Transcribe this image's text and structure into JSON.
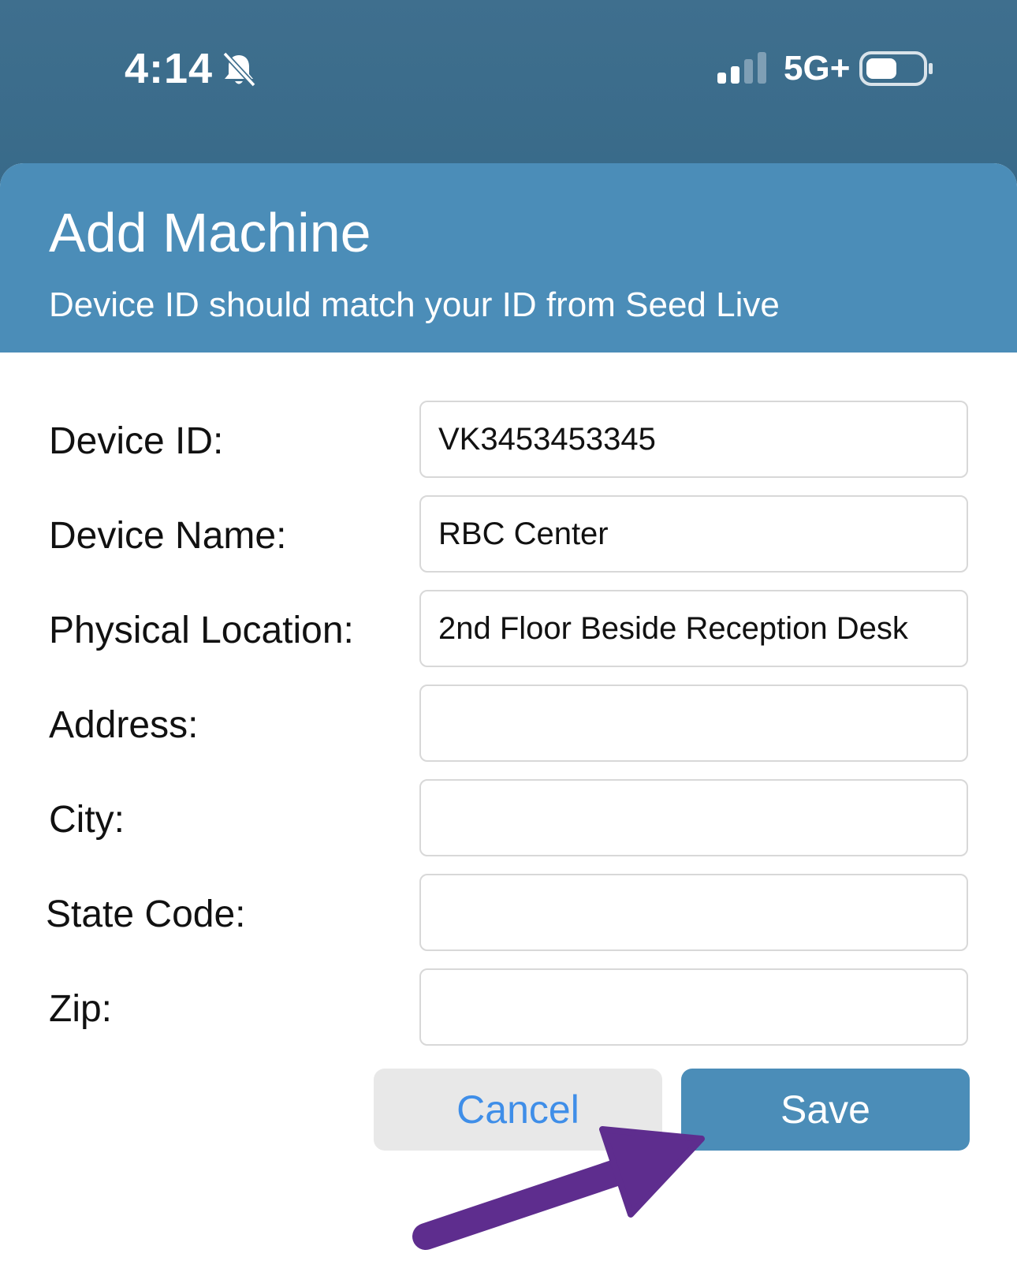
{
  "status_bar": {
    "time": "4:14",
    "network": "5G+",
    "icons": [
      "bell-slash-icon",
      "signal-icon",
      "battery-icon"
    ]
  },
  "sheet": {
    "title": "Add Machine",
    "subtitle": "Device ID should match your ID from Seed Live"
  },
  "form": {
    "fields": [
      {
        "label": "Device ID:",
        "value": "VK3453453345",
        "placeholder": ""
      },
      {
        "label": "Device Name:",
        "value": "RBC Center",
        "placeholder": ""
      },
      {
        "label": "Physical Location:",
        "value": "2nd Floor Beside Reception Desk",
        "placeholder": ""
      },
      {
        "label": "Address:",
        "value": "",
        "placeholder": ""
      },
      {
        "label": "City:",
        "value": "",
        "placeholder": ""
      },
      {
        "label": "State Code:",
        "value": "",
        "placeholder": ""
      },
      {
        "label": "Zip:",
        "value": "",
        "placeholder": ""
      }
    ]
  },
  "buttons": {
    "cancel_label": "Cancel",
    "save_label": "Save"
  },
  "annotation": {
    "arrow_color": "#5e2d8e",
    "points_to": "save-button"
  },
  "colors": {
    "status_bar": "#3f6f8e",
    "header": "#4b8db8",
    "save_button": "#4b8db8",
    "cancel_button": "#e8e8e8",
    "cancel_text": "#3f8ee8"
  }
}
